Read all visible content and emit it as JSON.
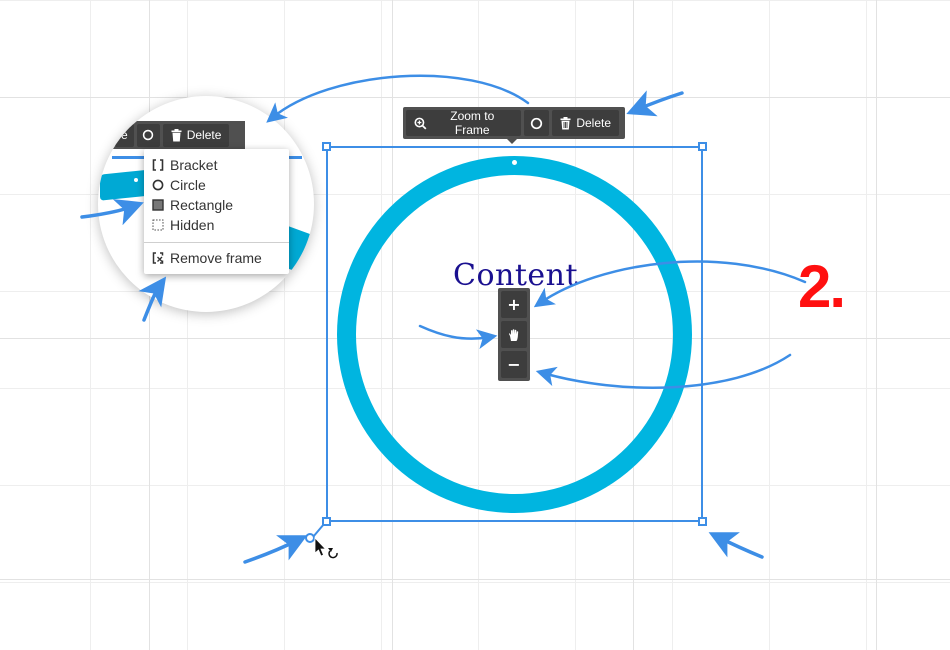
{
  "toolbar": {
    "zoom_label": "Zoom to Frame",
    "delete_label": "Delete"
  },
  "magnifier": {
    "toolbar": {
      "partial_label": "e",
      "delete_label": "Delete"
    },
    "menu": {
      "items": [
        {
          "label": "Bracket",
          "icon": "bracket-icon"
        },
        {
          "label": "Circle",
          "icon": "circle-icon"
        },
        {
          "label": "Rectangle",
          "icon": "rectangle-icon"
        },
        {
          "label": "Hidden",
          "icon": "hidden-frame-icon"
        }
      ],
      "remove_label": "Remove frame"
    }
  },
  "canvas": {
    "frame_content": "Content",
    "step_label": "2."
  },
  "zoom_controls": {
    "zoom_in": "+",
    "pan": "hand-icon",
    "zoom_out": "−"
  },
  "colors": {
    "accent": "#3d8ee6",
    "ring": "#00b5e0",
    "toolbar_bg": "#505050",
    "button_bg": "#3d3d3d",
    "content_text": "#1a1090",
    "step_label": "#ff1010"
  }
}
